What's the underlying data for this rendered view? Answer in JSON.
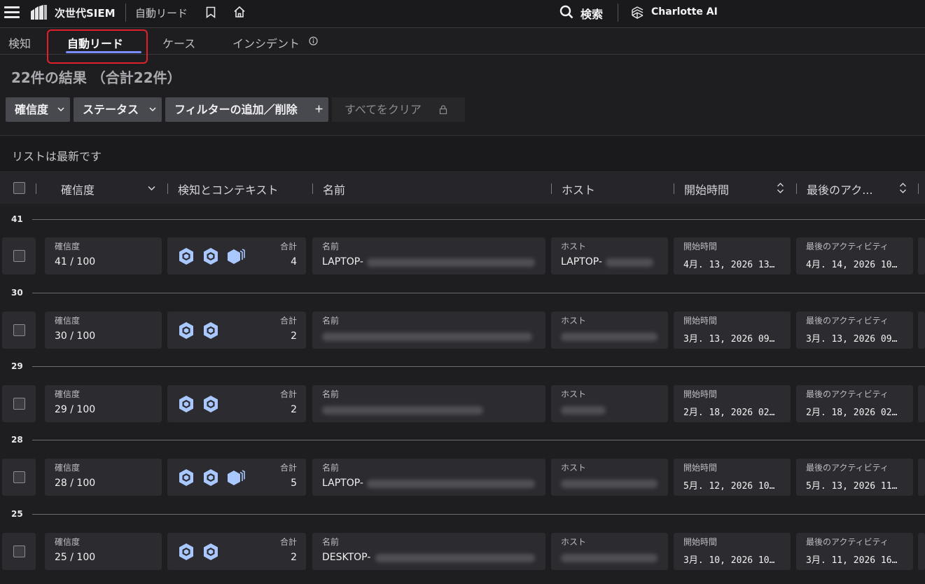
{
  "app": {
    "title": "次世代SIEM",
    "breadcrumb": "自動リード"
  },
  "topbar": {
    "search_label": "検索",
    "assistant_label": "Charlotte AI"
  },
  "tabs": [
    {
      "label": "検知"
    },
    {
      "label": "自動リード"
    },
    {
      "label": "ケース"
    },
    {
      "label": "インシデント"
    }
  ],
  "results": {
    "title": "22件の結果 （合計22件）"
  },
  "filters": {
    "confidence": "確信度",
    "status": "ステータス",
    "add_remove": "フィルターの追加／削除",
    "clear": "すべてをクリア"
  },
  "notice": "リストは最新です",
  "columns": {
    "confidence": "確信度",
    "detections": "検知とコンテキスト",
    "name": "名前",
    "host": "ホスト",
    "start_time": "開始時間",
    "last_activity": "最後のアク..."
  },
  "card_labels": {
    "confidence": "確信度",
    "total": "合計",
    "name": "名前",
    "host": "ホスト",
    "start_time": "開始時間",
    "last_activity": "最後のアクティビティ"
  },
  "groups": [
    {
      "score": "41",
      "confidence": "41 / 100",
      "total": "4",
      "name": "LAPTOP-",
      "host": "LAPTOP-",
      "start": "4月. 13, 2026 13…",
      "last": "4月. 14, 2026 10…"
    },
    {
      "score": "30",
      "confidence": "30 / 100",
      "total": "2",
      "name": "",
      "host": "",
      "start": "3月. 13, 2026 09…",
      "last": "3月. 13, 2026 09…"
    },
    {
      "score": "29",
      "confidence": "29 / 100",
      "total": "2",
      "name": "",
      "host": "",
      "start": "2月. 18, 2026 02…",
      "last": "2月. 18, 2026 02…"
    },
    {
      "score": "28",
      "confidence": "28 / 100",
      "total": "5",
      "name": "LAPTOP-",
      "host": "",
      "start": "5月. 12, 2026 10…",
      "last": "5月. 13, 2026 11…"
    },
    {
      "score": "25",
      "confidence": "25 / 100",
      "total": "2",
      "name": "DESKTOP-",
      "host": "",
      "start": "3月. 10, 2026 10…",
      "last": "3月. 11, 2026 16…"
    }
  ],
  "colors": {
    "accent": "#7b8cff",
    "highlight": "#e0202a",
    "icon": "#a9c8ff"
  }
}
